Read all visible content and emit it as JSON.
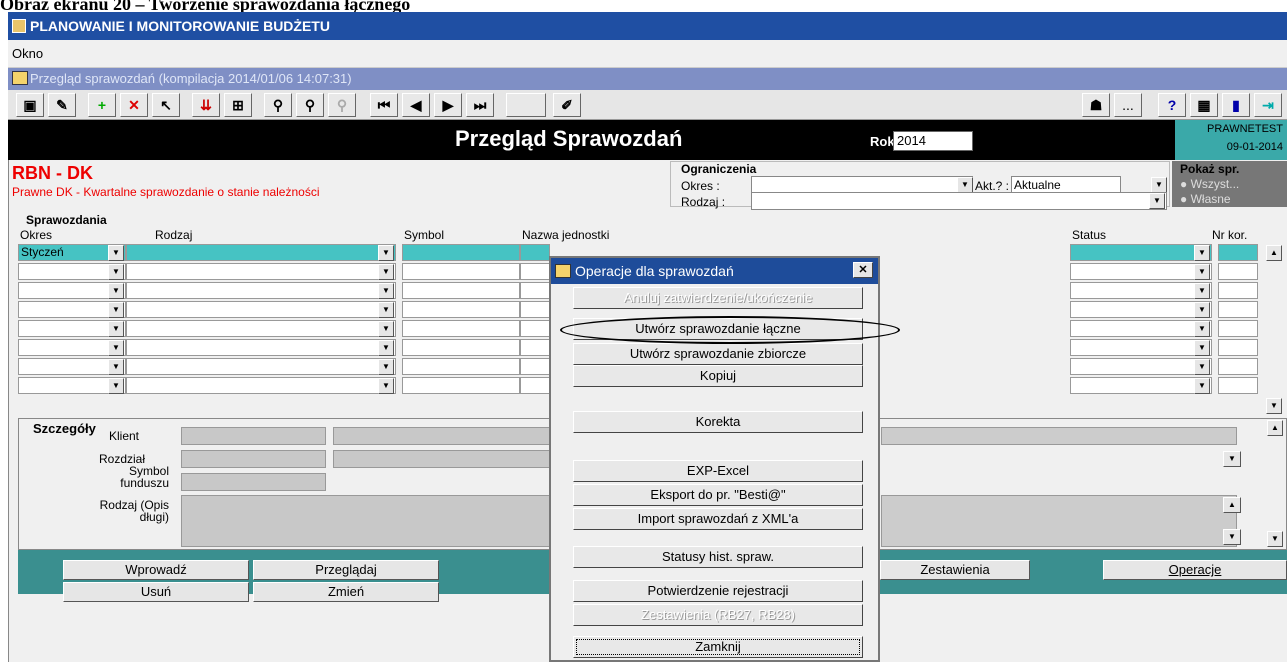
{
  "caption": "Obraz ekranu 20 – Tworzenie sprawozdania łącznego",
  "window": {
    "title": "PLANOWANIE I MONITOROWANIE BUDŻETU",
    "menu": "Okno",
    "subtitle": "Przegląd sprawozdań (kompilacja 2014/01/06 14:07:31)"
  },
  "toolbar": {
    "ellipsis": "...",
    "help": "?"
  },
  "header": {
    "title": "Przegląd Sprawozdań",
    "rok_label": "Rok",
    "rok_value": "2014",
    "user": "PRAWNETEST",
    "date": "09-01-2014"
  },
  "report": {
    "code": "RBN - DK",
    "description": "Prawne DK - Kwartalne sprawozdanie o stanie należności"
  },
  "ograniczenia": {
    "title": "Ograniczenia",
    "okres_label": "Okres :",
    "akt_label": "Akt.? :",
    "akt_value": "Aktualne",
    "rodzaj_label": "Rodzaj :"
  },
  "pokaz": {
    "title": "Pokaż spr.",
    "opt1": "Wszyst...",
    "opt2": "Własne"
  },
  "grid": {
    "title": "Sprawozdania",
    "headers": [
      "Okres",
      "Rodzaj",
      "Symbol",
      "Nazwa jednostki",
      "Status",
      "Nr kor."
    ],
    "first_okres": "Styczeń"
  },
  "details": {
    "title": "Szczegóły",
    "klient": "Klient",
    "rozdzial": "Rozdział",
    "symbol": "Symbol funduszu",
    "rodzaj": "Rodzaj (Opis długi)"
  },
  "buttons": {
    "wprowadz": "Wprowadź",
    "przegladaj": "Przeglądaj",
    "usun": "Usuń",
    "zmien": "Zmień",
    "zestawienia": "Zestawienia",
    "operacje": "Operacje"
  },
  "dialog": {
    "title": "Operacje dla sprawozdań",
    "b1": "Anuluj zatwierdzenie/ukończenie",
    "b2": "Utwórz sprawozdanie łączne",
    "b3": "Utwórz sprawozdanie zbiorcze",
    "b4": "Kopiuj",
    "b5": "Korekta",
    "b6": "EXP-Excel",
    "b7": "Eksport do pr. \"Besti@\"",
    "b8": "Import sprawozdań z XML'a",
    "b9": "Statusy hist. spraw.",
    "b10": "Potwierdzenie rejestracji",
    "b11": "Zestawienia (RB27, RB28)",
    "b12": "Zamknij"
  }
}
